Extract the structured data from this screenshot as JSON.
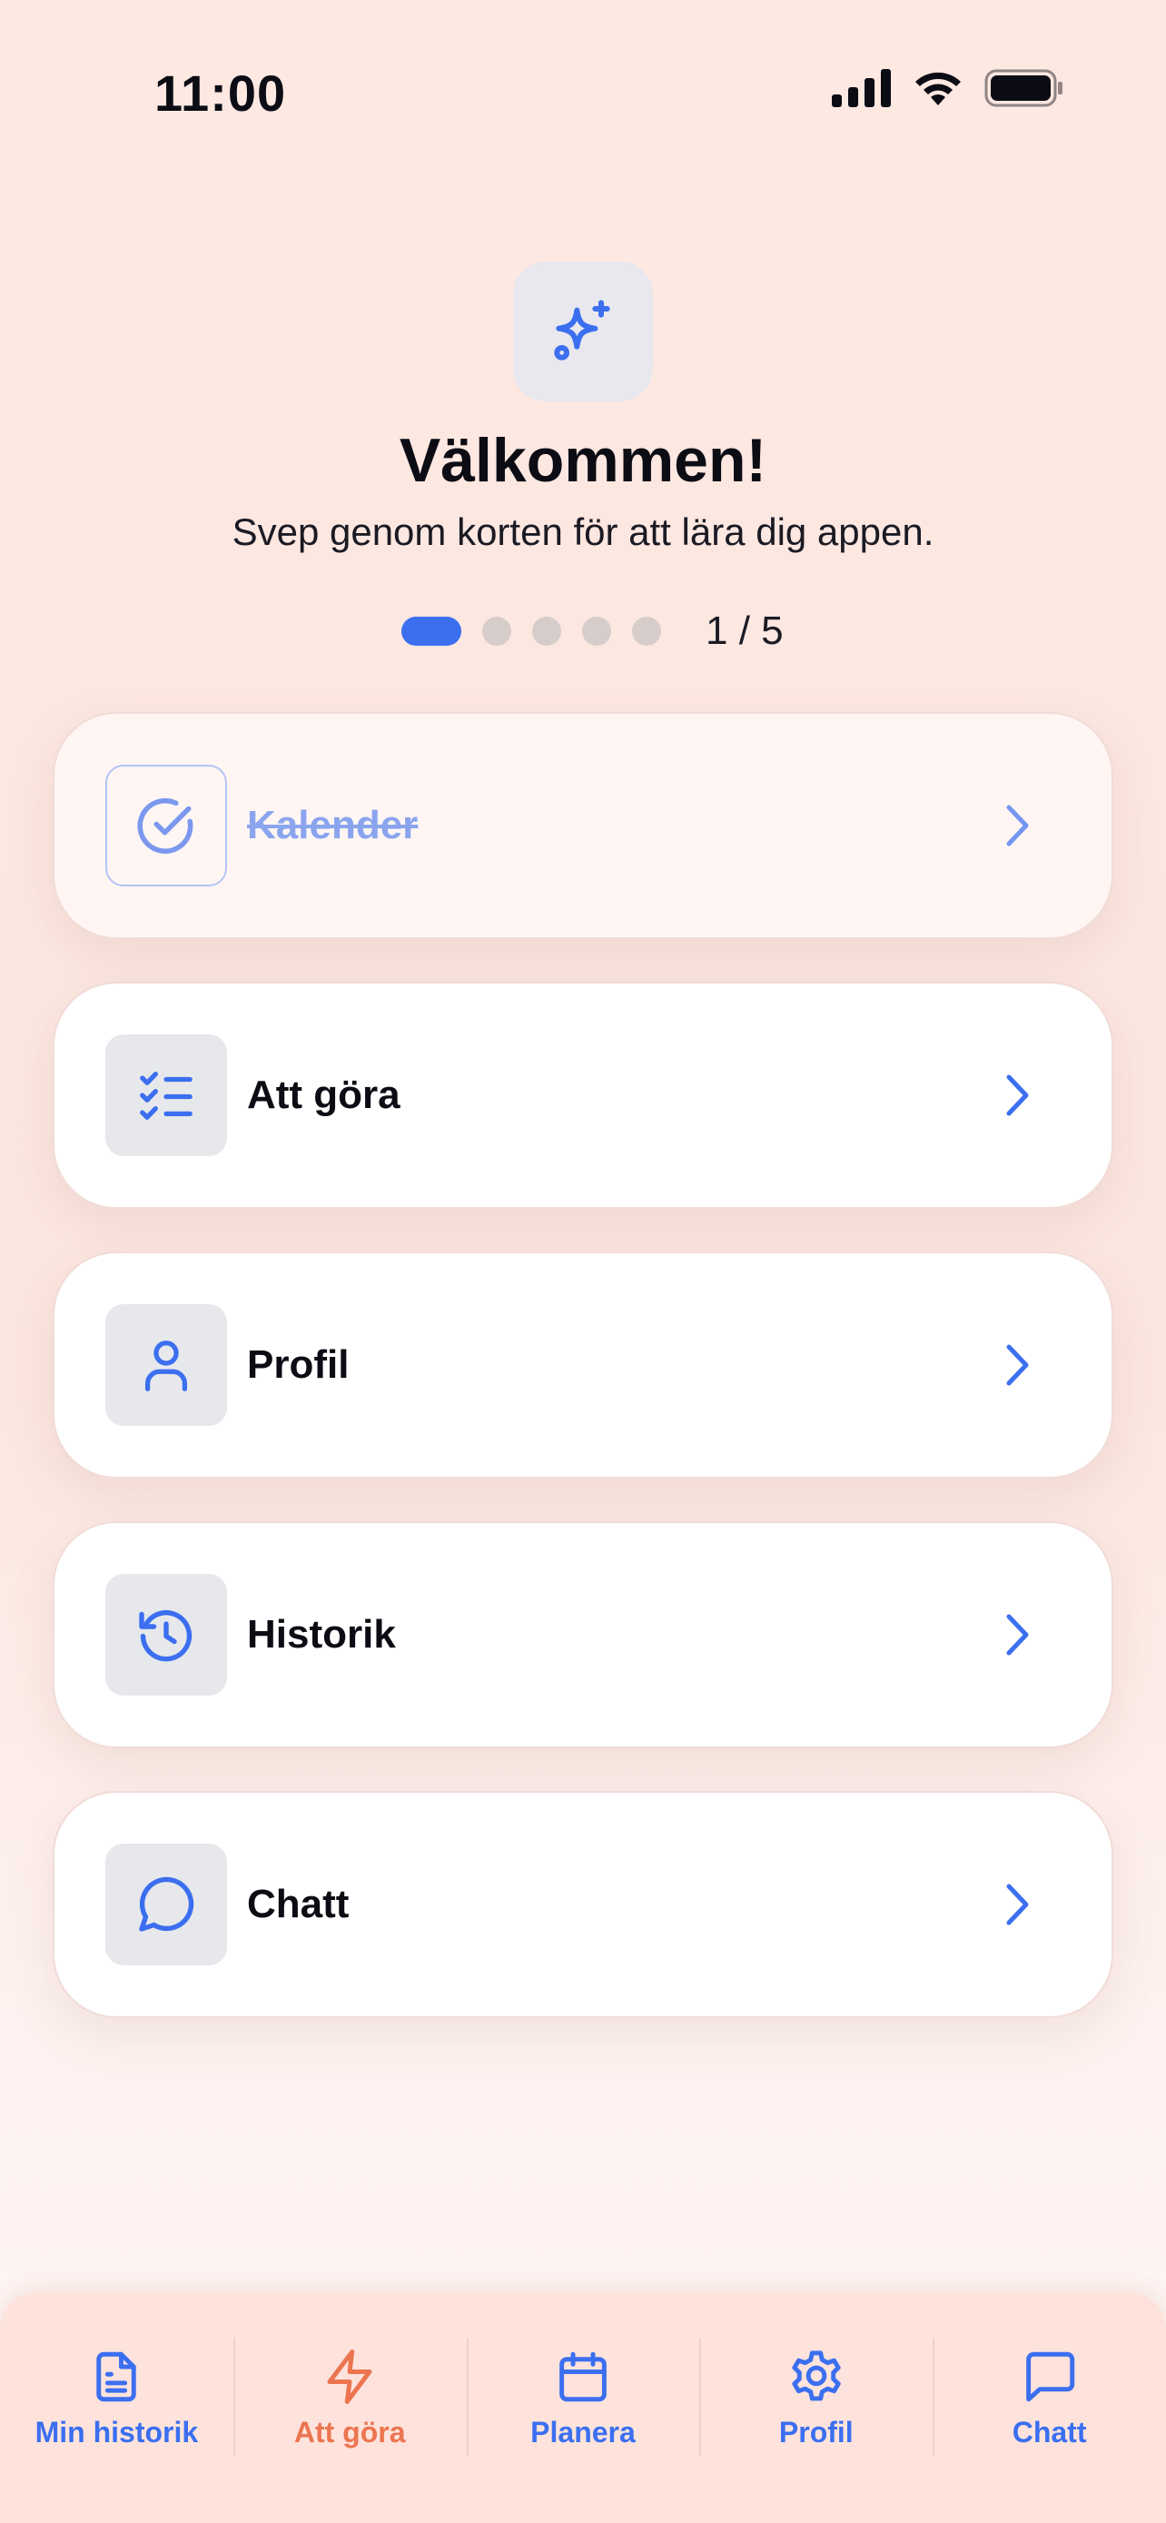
{
  "status_bar": {
    "time": "11:00"
  },
  "colors": {
    "accent": "#3b6ff0",
    "active_tab": "#ec7550",
    "background": "#fde8e2"
  },
  "header": {
    "icon": "sparkles-icon",
    "title": "Välkommen!",
    "subtitle": "Svep genom korten för att lära dig appen.",
    "pager": {
      "current": 1,
      "total": 5,
      "label": "1 / 5"
    }
  },
  "cards": [
    {
      "label": "Kalender",
      "icon": "check-circle-icon",
      "completed": true
    },
    {
      "label": "Att göra",
      "icon": "checklist-icon",
      "completed": false
    },
    {
      "label": "Profil",
      "icon": "user-icon",
      "completed": false
    },
    {
      "label": "Historik",
      "icon": "history-icon",
      "completed": false
    },
    {
      "label": "Chatt",
      "icon": "chat-bubble-icon",
      "completed": false
    }
  ],
  "tab_bar": {
    "tabs": [
      {
        "label": "Min historik",
        "icon": "document-icon",
        "active": false
      },
      {
        "label": "Att göra",
        "icon": "lightning-icon",
        "active": true
      },
      {
        "label": "Planera",
        "icon": "calendar-icon",
        "active": false
      },
      {
        "label": "Profil",
        "icon": "gear-icon",
        "active": false
      },
      {
        "label": "Chatt",
        "icon": "message-square-icon",
        "active": false
      }
    ]
  }
}
